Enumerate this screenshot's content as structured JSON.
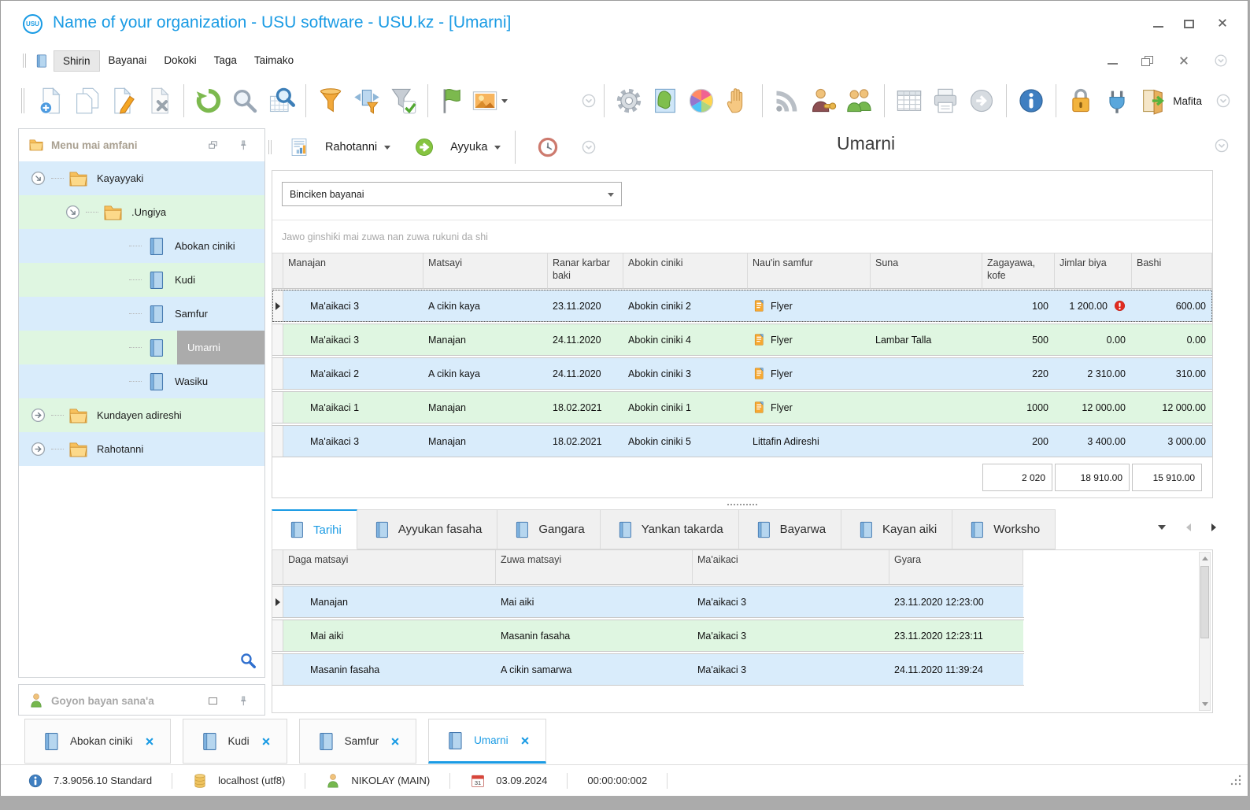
{
  "window": {
    "title": "Name of your organization - USU software - USU.kz - [Umarni]",
    "logo_text": "USU"
  },
  "menu": {
    "items": [
      {
        "label": "Shirin",
        "active": true
      },
      {
        "label": "Bayanai",
        "active": false
      },
      {
        "label": "Dokoki",
        "active": false
      },
      {
        "label": "Taga",
        "active": false
      },
      {
        "label": "Taimako",
        "active": false
      }
    ]
  },
  "toolbar": {
    "left_groups": [
      [
        "doc-new",
        "doc-copy",
        "doc-edit",
        "doc-delete"
      ],
      [
        "refresh",
        "search",
        "search-grid"
      ],
      [
        "filter",
        "filter-columns",
        "filter-check"
      ],
      [
        "flag",
        "image"
      ]
    ],
    "right_groups": [
      [
        "gear",
        "map",
        "colors",
        "hand"
      ],
      [
        "rss",
        "user-key",
        "users"
      ],
      [
        "grid",
        "printer",
        "go-gray"
      ],
      [
        "info"
      ],
      [
        "lock",
        "plug",
        "exit"
      ]
    ],
    "mafita_label": "Mafita"
  },
  "sidebar": {
    "header": {
      "title": "Menu mai amfani"
    },
    "tree": [
      {
        "label": "Kayayyaki",
        "type": "folder",
        "level": 0,
        "expander": "open"
      },
      {
        "label": ".Ungiya",
        "type": "folder",
        "level": 1,
        "expander": "open"
      },
      {
        "label": "Abokan ciniki",
        "type": "book",
        "level": 2
      },
      {
        "label": "Kudi",
        "type": "book",
        "level": 2
      },
      {
        "label": "Samfur",
        "type": "book",
        "level": 2
      },
      {
        "label": "Umarni",
        "type": "book",
        "level": 2,
        "selected": true
      },
      {
        "label": "Wasiku",
        "type": "book",
        "level": 2
      },
      {
        "label": "Kundayen adireshi",
        "type": "folder",
        "level": 0,
        "expander": "closed"
      },
      {
        "label": "Rahotanni",
        "type": "folder",
        "level": 0,
        "expander": "closed"
      }
    ],
    "support_panel": {
      "title": "Goyon bayan sana'a"
    }
  },
  "main": {
    "toolbar": {
      "reports_label": "Rahotanni",
      "actions_label": "Ayyuka"
    },
    "title": "Umarni",
    "search_combo": {
      "value": "Binciken bayanai"
    },
    "group_hint": "Jawo ginshiƙi mai zuwa nan zuwa rukuni da shi",
    "orders_table": {
      "columns": [
        "Manajan",
        "Matsayi",
        "Ranar karbar baki",
        "Abokin ciniki",
        "Nau'in samfur",
        "Suna",
        "Zagayawa, kofe",
        "Jimlar biya",
        "Bashi"
      ],
      "rows": [
        {
          "manajan": "Ma'aikaci 3",
          "matsayi": "A cikin kaya",
          "date": "23.11.2020",
          "client": "Abokin ciniki 2",
          "product": "Flyer",
          "product_icon": "flyer-icon",
          "suna": "",
          "qty": "100",
          "total": "1 200.00",
          "alert": true,
          "bashi": "600.00",
          "selected": true
        },
        {
          "manajan": "Ma'aikaci 3",
          "matsayi": "Manajan",
          "date": "24.11.2020",
          "client": "Abokin ciniki 4",
          "product": "Flyer",
          "product_icon": "flyer-icon",
          "suna": "Lambar Talla",
          "qty": "500",
          "total": "0.00",
          "alert": false,
          "bashi": "0.00",
          "selected": false
        },
        {
          "manajan": "Ma'aikaci 2",
          "matsayi": "A cikin kaya",
          "date": "24.11.2020",
          "client": "Abokin ciniki 3",
          "product": "Flyer",
          "product_icon": "flyer-icon",
          "suna": "",
          "qty": "220",
          "total": "2 310.00",
          "alert": false,
          "bashi": "310.00",
          "selected": false
        },
        {
          "manajan": "Ma'aikaci 1",
          "matsayi": "Manajan",
          "date": "18.02.2021",
          "client": "Abokin ciniki 1",
          "product": "Flyer",
          "product_icon": "flyer-icon",
          "suna": "",
          "qty": "1000",
          "total": "12 000.00",
          "alert": false,
          "bashi": "12 000.00",
          "selected": false
        },
        {
          "manajan": "Ma'aikaci 3",
          "matsayi": "Manajan",
          "date": "18.02.2021",
          "client": "Abokin ciniki 5",
          "product": "Littafin Adireshi",
          "product_icon": "",
          "suna": "",
          "qty": "200",
          "total": "3 400.00",
          "alert": false,
          "bashi": "3 000.00",
          "selected": false
        }
      ],
      "summary": {
        "qty": "2 020",
        "total": "18 910.00",
        "bashi": "15 910.00"
      }
    },
    "detail_tabs": [
      {
        "label": "Tarihi",
        "active": true
      },
      {
        "label": "Ayyukan fasaha",
        "active": false
      },
      {
        "label": "Gangara",
        "active": false
      },
      {
        "label": "Yankan takarda",
        "active": false
      },
      {
        "label": "Bayarwa",
        "active": false
      },
      {
        "label": "Kayan aiki",
        "active": false
      },
      {
        "label": "Worksho",
        "active": false
      }
    ],
    "history_table": {
      "columns": [
        "Daga matsayi",
        "Zuwa matsayi",
        "Ma'aikaci",
        "Gyara"
      ],
      "rows": [
        {
          "from": "Manajan",
          "to": "Mai aiki",
          "employee": "Ma'aikaci 3",
          "time": "23.11.2020 12:23:00",
          "selected": true
        },
        {
          "from": "Mai aiki",
          "to": "Masanin fasaha",
          "employee": "Ma'aikaci 3",
          "time": "23.11.2020 12:23:11",
          "selected": false
        },
        {
          "from": "Masanin fasaha",
          "to": "A cikin samarwa",
          "employee": "Ma'aikaci 3",
          "time": "24.11.2020 11:39:24",
          "selected": false
        }
      ]
    }
  },
  "doc_tabs": [
    {
      "label": "Abokan ciniki",
      "active": false
    },
    {
      "label": "Kudi",
      "active": false
    },
    {
      "label": "Samfur",
      "active": false
    },
    {
      "label": "Umarni",
      "active": true
    }
  ],
  "statusbar": {
    "version": "7.3.9056.10 Standard",
    "database": "localhost (utf8)",
    "user": "NIKOLAY (MAIN)",
    "calendar_day": "31",
    "date": "03.09.2024",
    "timer": "00:00:00:002"
  },
  "colors": {
    "accent": "#1a9be4",
    "row_blue": "#d9ecfb",
    "row_green": "#dff6e1",
    "selected_gray": "#ababab",
    "alert_red": "#dd2b20"
  }
}
